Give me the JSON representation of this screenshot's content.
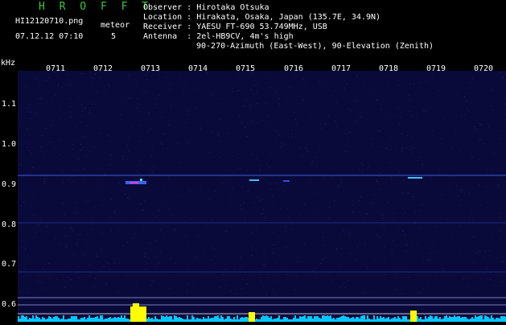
{
  "app": {
    "name": "H R O F F T",
    "file_name": "HI12120710.png",
    "meteor_label": "meteor",
    "meteor_count": "5",
    "datetime": "07.12.12 07:10"
  },
  "station": {
    "observer_label": "Observer :",
    "observer": "Hirotaka Otsuka",
    "location_label": "Location :",
    "location": "Hirakata, Osaka, Japan (135.7E, 34.9N)",
    "receiver_label": "Receiver :",
    "receiver": "YAESU FT-690 53.749MHz, USB",
    "antenna_label": "Antenna  :",
    "antenna": "2el-HB9CV, 4m's high",
    "antenna_detail": "90-270-Azimuth (East-West), 90-Elevation (Zenith)"
  },
  "axes": {
    "y_unit": "kHz",
    "y_ticks": [
      "1.1",
      "1.0",
      "0.9",
      "0.8",
      "0.7",
      "0.6"
    ],
    "x_ticks": [
      "0711",
      "0712",
      "0713",
      "0714",
      "0715",
      "0716",
      "0717",
      "0718",
      "0719",
      "0720"
    ]
  },
  "colors": {
    "background": "#000000",
    "spectrogram": "#0a0a3a",
    "brand": "#39c83c",
    "signal": "#1e50c8",
    "meteor": "#ffff00",
    "baseline": "#00c8ff"
  }
}
